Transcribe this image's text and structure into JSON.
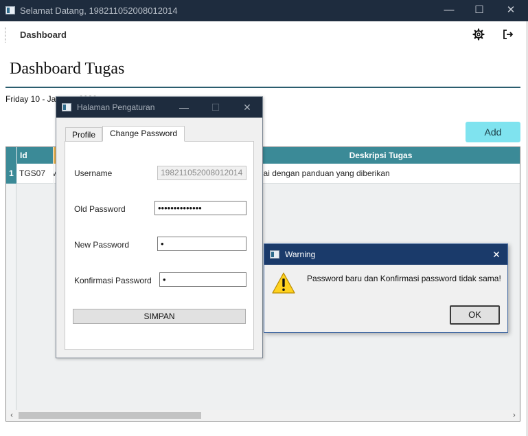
{
  "window": {
    "title": "Selamat Datang, 198211052008012014",
    "minimize_glyph": "—",
    "maximize_glyph": "☐",
    "close_glyph": "✕"
  },
  "header": {
    "nav_title": "Dashboard",
    "icons": [
      "gear-icon",
      "logout-icon"
    ]
  },
  "page": {
    "title": "Dashboard Tugas",
    "date": "Friday 10 - January 2020",
    "add_label": "Add"
  },
  "table": {
    "columns": [
      "Id Tugas",
      "Deskripsi Tugas"
    ],
    "rows": [
      {
        "num": "1",
        "id": "TGS07",
        "description": "Membuat video pidato menggunakan Bahasa Inggris sesuai dengan panduan yang diberikan"
      }
    ],
    "scroll_left_glyph": "‹",
    "scroll_right_glyph": "›"
  },
  "settings_dialog": {
    "title": "Halaman Pengaturan",
    "tabs": [
      "Profile",
      "Change Password"
    ],
    "active_tab": "Change Password",
    "fields": {
      "username_label": "Username",
      "username_value": "198211052008012014",
      "old_password_label": "Old Password",
      "old_password_value": "••••••••••••••",
      "new_password_label": "New Password",
      "new_password_value": "•",
      "confirm_password_label": "Konfirmasi Password",
      "confirm_password_value": "•"
    },
    "save_label": "SIMPAN"
  },
  "warning_dialog": {
    "title": "Warning",
    "message": "Password baru dan Konfirmasi password tidak sama!",
    "ok_label": "OK",
    "close_glyph": "✕"
  },
  "colors": {
    "titlebar": "#1e2c3e",
    "accent_teal": "#3b8a97",
    "add_button": "#7fe3ef",
    "warning_titlebar": "#1a3a6a"
  }
}
